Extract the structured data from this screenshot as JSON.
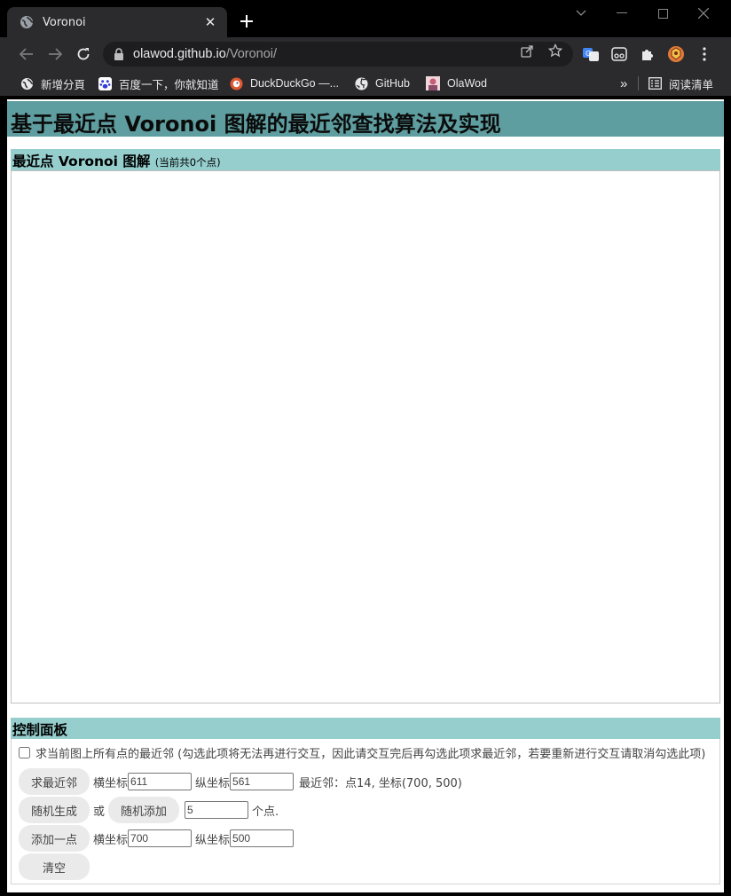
{
  "browser": {
    "tab_title": "Voronoi",
    "url_host": "olawod.github.io",
    "url_path": "/Voronoi/",
    "bookmarks": [
      "新增分頁",
      "百度一下，你就知道",
      "DuckDuckGo —...",
      "GitHub",
      "OlaWod"
    ],
    "reading_list": "阅读清单",
    "more_bookmarks": "»"
  },
  "page": {
    "title": "基于最近点 Voronoi 图解的最近邻查找算法及实现",
    "diagram_heading": "最近点 Voronoi 图解",
    "diagram_count": "(当前共0个点)",
    "control_heading": "控制面板",
    "all_nn_label": "求当前图上所有点的最近邻 (勾选此项将无法再进行交互，因此请交互完后再勾选此项求最近邻，若要重新进行交互请取消勾选此项)",
    "find_nn_button": "求最近邻",
    "x_label": "横坐标",
    "y_label": "纵坐标",
    "query_x": "611",
    "query_y": "561",
    "nn_result": "最近邻：点14, 坐标(700, 500)",
    "random_gen_button": "随机生成",
    "or_label": "或",
    "random_add_button": "随机添加",
    "random_count": "5",
    "points_suffix": "个点.",
    "add_point_button": "添加一点",
    "add_x": "700",
    "add_y": "500",
    "clear_button": "清空"
  }
}
